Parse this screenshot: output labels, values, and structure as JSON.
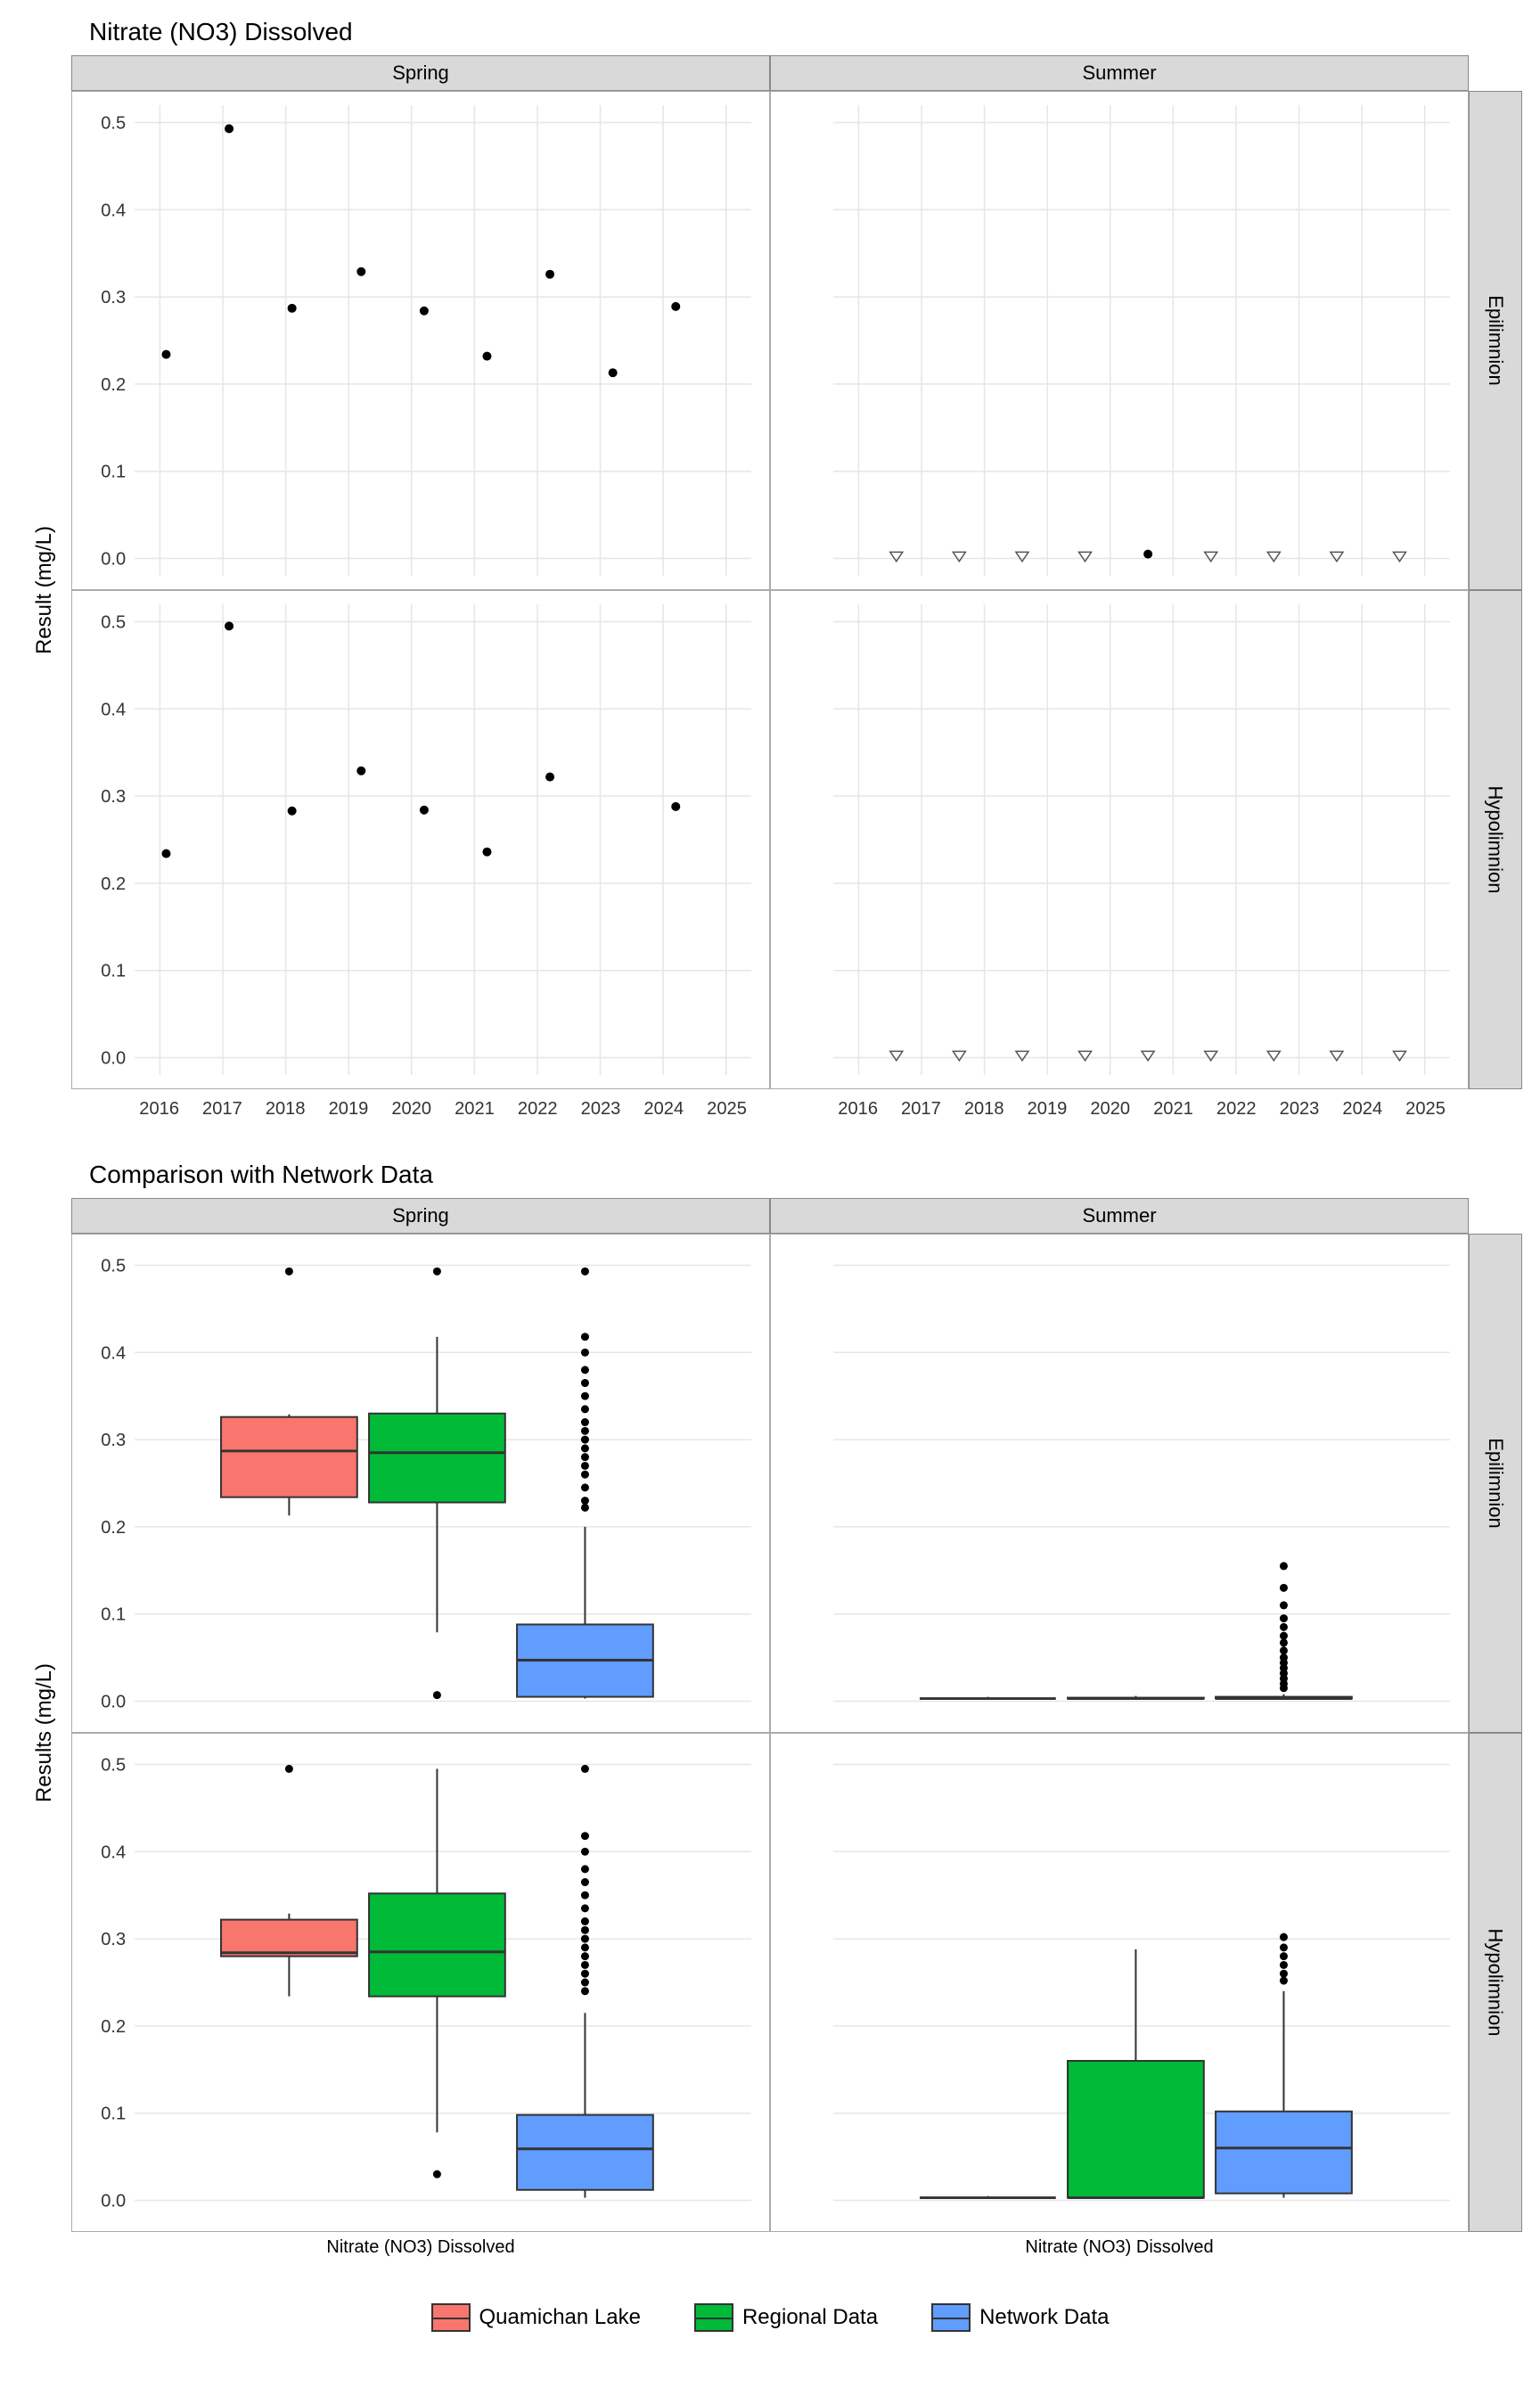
{
  "chart_data": [
    {
      "type": "scatter",
      "title": "Nitrate (NO3) Dissolved",
      "ylabel": "Result (mg/L)",
      "facets_col": [
        "Spring",
        "Summer"
      ],
      "facets_row": [
        "Epilimnion",
        "Hypolimnion"
      ],
      "x_ticks": [
        2016,
        2017,
        2018,
        2019,
        2020,
        2021,
        2022,
        2023,
        2024,
        2025
      ],
      "y_ticks": [
        0.0,
        0.1,
        0.2,
        0.3,
        0.4,
        0.5
      ],
      "ylim": [
        0.0,
        0.5
      ],
      "series": {
        "Spring_Epilimnion": [
          {
            "x": 2016.1,
            "y": 0.234
          },
          {
            "x": 2017.1,
            "y": 0.493
          },
          {
            "x": 2018.1,
            "y": 0.287
          },
          {
            "x": 2019.2,
            "y": 0.329
          },
          {
            "x": 2020.2,
            "y": 0.284
          },
          {
            "x": 2021.2,
            "y": 0.232
          },
          {
            "x": 2022.2,
            "y": 0.326
          },
          {
            "x": 2023.2,
            "y": 0.213
          },
          {
            "x": 2024.2,
            "y": 0.289
          }
        ],
        "Spring_Hypolimnion": [
          {
            "x": 2016.1,
            "y": 0.234
          },
          {
            "x": 2017.1,
            "y": 0.495
          },
          {
            "x": 2018.1,
            "y": 0.283
          },
          {
            "x": 2019.2,
            "y": 0.329
          },
          {
            "x": 2020.2,
            "y": 0.284
          },
          {
            "x": 2021.2,
            "y": 0.236
          },
          {
            "x": 2022.2,
            "y": 0.322
          },
          {
            "x": 2024.2,
            "y": 0.288
          }
        ],
        "Summer_Epilimnion_open": [
          {
            "x": 2016.6,
            "y": 0.003
          },
          {
            "x": 2017.6,
            "y": 0.003
          },
          {
            "x": 2018.6,
            "y": 0.003
          },
          {
            "x": 2019.6,
            "y": 0.003
          },
          {
            "x": 2021.6,
            "y": 0.003
          },
          {
            "x": 2022.6,
            "y": 0.003
          },
          {
            "x": 2023.6,
            "y": 0.003
          },
          {
            "x": 2024.6,
            "y": 0.003
          }
        ],
        "Summer_Epilimnion_solid": [
          {
            "x": 2020.6,
            "y": 0.005
          }
        ],
        "Summer_Hypolimnion_open": [
          {
            "x": 2016.6,
            "y": 0.003
          },
          {
            "x": 2017.6,
            "y": 0.003
          },
          {
            "x": 2018.6,
            "y": 0.003
          },
          {
            "x": 2019.6,
            "y": 0.003
          },
          {
            "x": 2020.6,
            "y": 0.003
          },
          {
            "x": 2021.6,
            "y": 0.003
          },
          {
            "x": 2022.6,
            "y": 0.003
          },
          {
            "x": 2023.6,
            "y": 0.003
          },
          {
            "x": 2024.6,
            "y": 0.003
          }
        ]
      }
    },
    {
      "type": "boxplot",
      "title": "Comparison with Network Data",
      "ylabel": "Results (mg/L)",
      "x_category": "Nitrate (NO3) Dissolved",
      "facets_col": [
        "Spring",
        "Summer"
      ],
      "facets_row": [
        "Epilimnion",
        "Hypolimnion"
      ],
      "y_ticks": [
        0.0,
        0.1,
        0.2,
        0.3,
        0.4,
        0.5
      ],
      "ylim": [
        0.0,
        0.5
      ],
      "legend": [
        "Quamichan Lake",
        "Regional Data",
        "Network Data"
      ],
      "colors": {
        "Quamichan Lake": "#F8766D",
        "Regional Data": "#00BA38",
        "Network Data": "#619CFF"
      },
      "boxes": {
        "Spring_Epilimnion": [
          {
            "g": "Quamichan Lake",
            "min": 0.213,
            "q1": 0.234,
            "med": 0.287,
            "q3": 0.326,
            "max": 0.329,
            "out": [
              0.493
            ]
          },
          {
            "g": "Regional Data",
            "min": 0.079,
            "q1": 0.228,
            "med": 0.285,
            "q3": 0.33,
            "max": 0.418,
            "out": [
              0.493,
              0.007
            ]
          },
          {
            "g": "Network Data",
            "min": 0.003,
            "q1": 0.005,
            "med": 0.047,
            "q3": 0.088,
            "max": 0.2,
            "out": [
              0.493,
              0.418,
              0.4,
              0.38,
              0.365,
              0.35,
              0.335,
              0.32,
              0.31,
              0.3,
              0.29,
              0.28,
              0.27,
              0.26,
              0.245,
              0.23,
              0.222
            ]
          }
        ],
        "Spring_Hypolimnion": [
          {
            "g": "Quamichan Lake",
            "min": 0.234,
            "q1": 0.28,
            "med": 0.284,
            "q3": 0.322,
            "max": 0.329,
            "out": [
              0.495
            ]
          },
          {
            "g": "Regional Data",
            "min": 0.078,
            "q1": 0.234,
            "med": 0.285,
            "q3": 0.352,
            "max": 0.495,
            "out": [
              0.03
            ]
          },
          {
            "g": "Network Data",
            "min": 0.003,
            "q1": 0.012,
            "med": 0.059,
            "q3": 0.098,
            "max": 0.215,
            "out": [
              0.495,
              0.418,
              0.4,
              0.38,
              0.365,
              0.35,
              0.335,
              0.32,
              0.31,
              0.3,
              0.29,
              0.28,
              0.27,
              0.26,
              0.25,
              0.24
            ]
          }
        ],
        "Summer_Epilimnion": [
          {
            "g": "Quamichan Lake",
            "min": 0.003,
            "q1": 0.003,
            "med": 0.003,
            "q3": 0.003,
            "max": 0.005,
            "out": []
          },
          {
            "g": "Regional Data",
            "min": 0.003,
            "q1": 0.003,
            "med": 0.003,
            "q3": 0.004,
            "max": 0.006,
            "out": []
          },
          {
            "g": "Network Data",
            "min": 0.003,
            "q1": 0.003,
            "med": 0.003,
            "q3": 0.005,
            "max": 0.008,
            "out": [
              0.155,
              0.13,
              0.11,
              0.095,
              0.085,
              0.075,
              0.067,
              0.058,
              0.05,
              0.044,
              0.038,
              0.032,
              0.026,
              0.02,
              0.015
            ]
          }
        ],
        "Summer_Hypolimnion": [
          {
            "g": "Quamichan Lake",
            "min": 0.003,
            "q1": 0.003,
            "med": 0.003,
            "q3": 0.003,
            "max": 0.005,
            "out": []
          },
          {
            "g": "Regional Data",
            "min": 0.003,
            "q1": 0.003,
            "med": 0.003,
            "q3": 0.16,
            "max": 0.288,
            "out": []
          },
          {
            "g": "Network Data",
            "min": 0.003,
            "q1": 0.008,
            "med": 0.06,
            "q3": 0.102,
            "max": 0.24,
            "out": [
              0.302,
              0.29,
              0.28,
              0.27,
              0.26,
              0.252
            ]
          }
        ]
      }
    }
  ]
}
